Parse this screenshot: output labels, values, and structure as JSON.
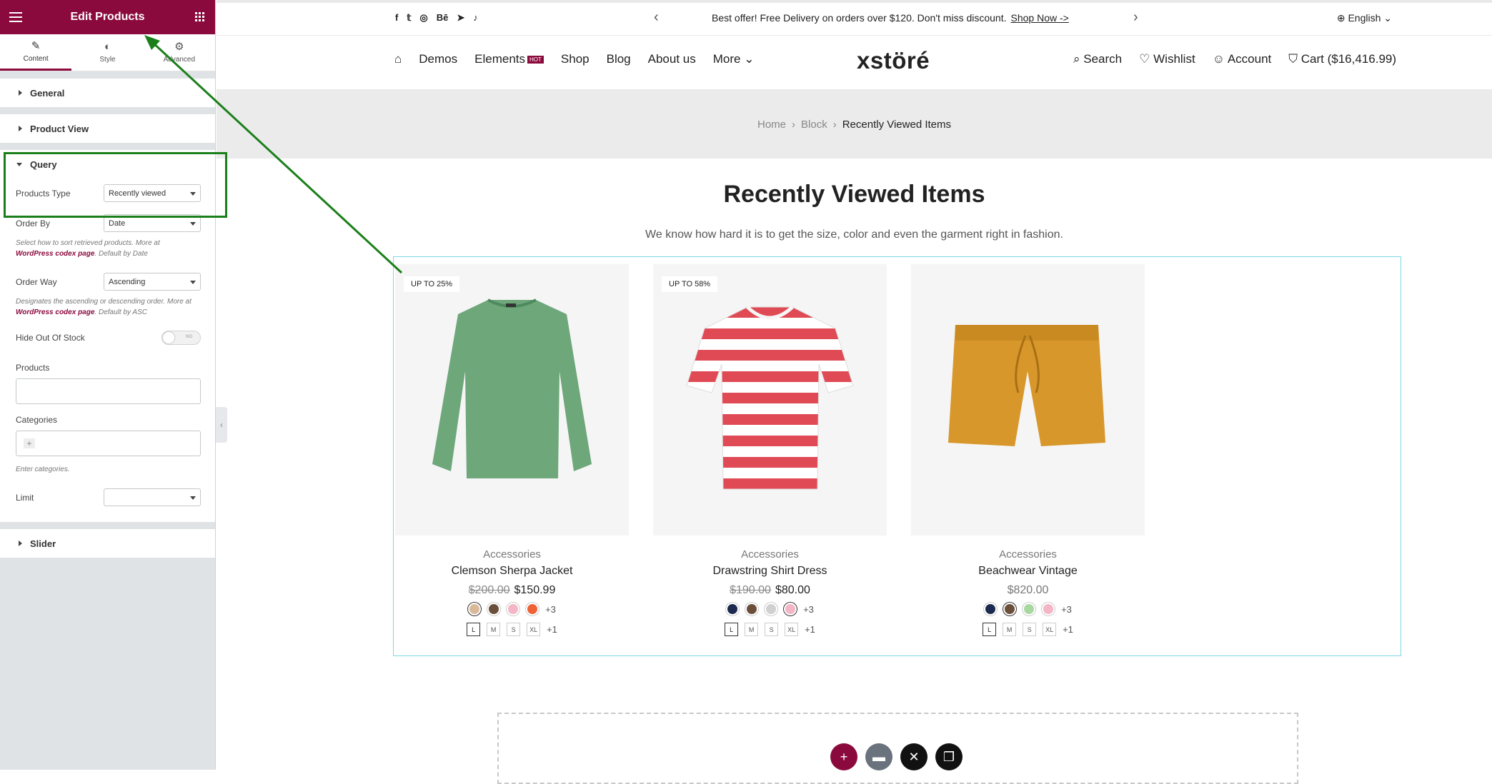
{
  "panel": {
    "title": "Edit Products",
    "tabs": [
      "Content",
      "Style",
      "Advanced"
    ],
    "sections": {
      "general": "General",
      "product_view": "Product View",
      "query": "Query",
      "slider": "Slider"
    },
    "query": {
      "products_type_label": "Products Type",
      "products_type_value": "Recently viewed",
      "order_by_label": "Order By",
      "order_by_value": "Date",
      "order_by_hint": "Select how to sort retrieved products. More at",
      "order_by_link": "WordPress codex page",
      "order_by_tail": ". Default by Date",
      "order_way_label": "Order Way",
      "order_way_value": "Ascending",
      "order_way_hint": "Designates the ascending or descending order. More at",
      "order_way_link": "WordPress codex page",
      "order_way_tail": ". Default by ASC",
      "hide_oos_label": "Hide Out Of Stock",
      "toggle_text": "NO",
      "products_label": "Products",
      "categories_label": "Categories",
      "categories_hint": "Enter categories.",
      "limit_label": "Limit"
    }
  },
  "topbar": {
    "promo": "Best offer! Free Delivery on orders over $120. Don't miss discount.",
    "promo_link": "Shop Now ->",
    "lang": "English"
  },
  "nav": {
    "items": [
      "Demos",
      "Elements",
      "Shop",
      "Blog",
      "About us",
      "More"
    ],
    "hot": "HOT",
    "logo": "xstöré",
    "search": "Search",
    "wishlist": "Wishlist",
    "account": "Account",
    "cart": "Cart ($16,416.99)"
  },
  "breadcrumb": {
    "home": "Home",
    "block": "Block",
    "current": "Recently Viewed Items"
  },
  "section": {
    "title": "Recently Viewed Items",
    "subtitle": "We know how hard it is to get the size, color and even the garment right in fashion."
  },
  "products": [
    {
      "badge": "UP TO 25%",
      "category": "Accessories",
      "name": "Clemson Sherpa Jacket",
      "old_price": "$200.00",
      "price": "$150.99",
      "colors": [
        "#d9b99a",
        "#6b4f3a",
        "#f4b5c6",
        "#ef6235"
      ],
      "more_colors": "+3",
      "sizes": [
        "L",
        "M",
        "S",
        "XL"
      ],
      "more_sizes": "+1"
    },
    {
      "badge": "UP TO 58%",
      "category": "Accessories",
      "name": "Drawstring Shirt Dress",
      "old_price": "$190.00",
      "price": "$80.00",
      "colors": [
        "#1b2a4e",
        "#6b4f3a",
        "#d0d0d0",
        "#f4b5c6"
      ],
      "more_colors": "+3",
      "sizes": [
        "L",
        "M",
        "S",
        "XL"
      ],
      "more_sizes": "+1"
    },
    {
      "badge": "",
      "category": "Accessories",
      "name": "Beachwear Vintage",
      "old_price": "",
      "price": "$820.00",
      "colors": [
        "#1b2a4e",
        "#6b4f3a",
        "#a8d8a0",
        "#f4b5c6"
      ],
      "more_colors": "+3",
      "sizes": [
        "L",
        "M",
        "S",
        "XL"
      ],
      "more_sizes": "+1"
    }
  ],
  "colors": {
    "accent": "#8b0a3d",
    "highlight": "#1a7f1a"
  }
}
